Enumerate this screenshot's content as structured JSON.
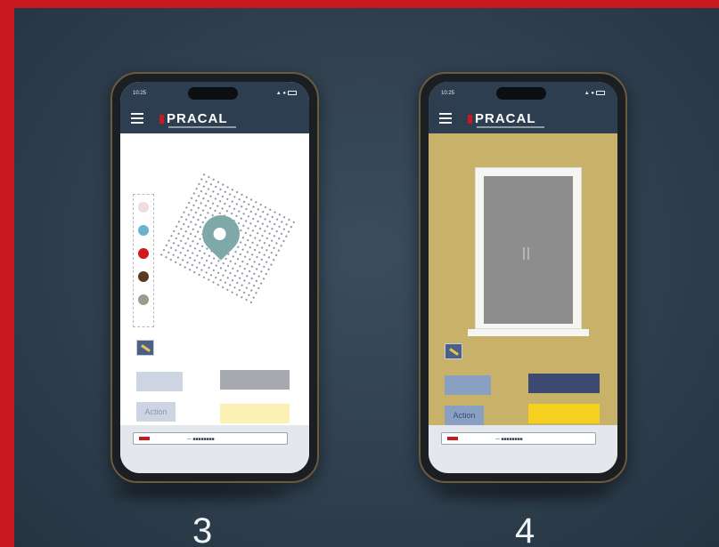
{
  "colors": {
    "frame": "#c81a1e",
    "background": "#2f3f4e",
    "appbar": "#2d3e50",
    "phone3_screen": "#ffffff",
    "phone4_screen": "#c8b26a",
    "pin": "#7fa9a8"
  },
  "phones": [
    {
      "step": "3",
      "status_time": "10:25",
      "status_right": "▲ ●",
      "logo": "PRACAL",
      "palette_colors": [
        "#f0dcdc",
        "#6ab3d0",
        "#d01a1a",
        "#5a3a1e",
        "#9b9b8e"
      ],
      "buttons": {
        "left_top": "",
        "right_top": "",
        "left_bottom": "Action",
        "right_bottom": ""
      },
      "bottom_text": "— ■■■■■■■■"
    },
    {
      "step": "4",
      "status_time": "10:25",
      "status_right": "▲ ●",
      "logo": "PRACAL",
      "buttons": {
        "left_top": "",
        "right_top": "",
        "left_bottom": "Action",
        "right_bottom": ""
      },
      "bottom_text": "— ■■■■■■■■"
    }
  ]
}
